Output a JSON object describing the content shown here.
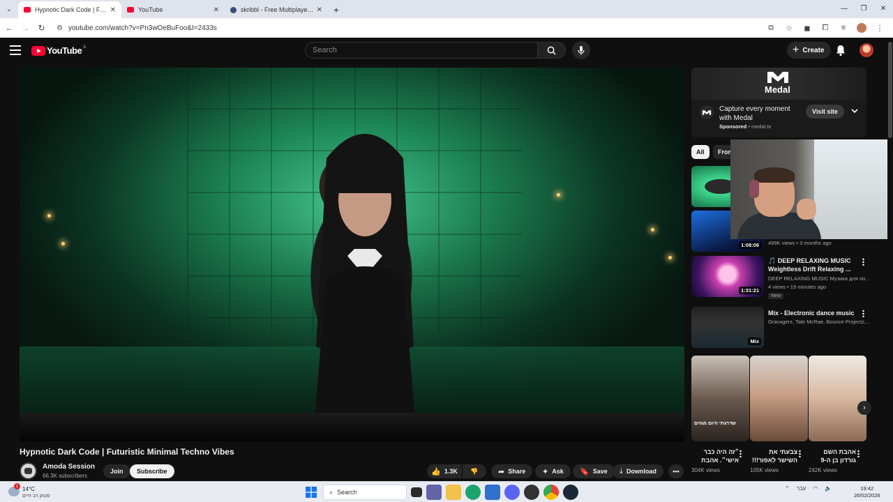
{
  "browser": {
    "tabs": [
      {
        "title": "Hypnotic Dark Code | Futuristic",
        "active": true
      },
      {
        "title": "YouTube",
        "active": false
      },
      {
        "title": "skribbl - Free Multiplayer Drawi",
        "active": false
      }
    ],
    "url": "youtube.com/watch?v=Pn3wOeBuFoo&t=2433s"
  },
  "masthead": {
    "logo_text": "YouTube",
    "country_code": "IL",
    "search_placeholder": "Search",
    "create_label": "Create"
  },
  "video": {
    "title": "Hypnotic Dark Code | Futuristic Minimal Techno Vibes",
    "channel": "Amoda Session",
    "subscribers": "66.3K subscribers",
    "join_label": "Join",
    "subscribe_label": "Subscribe",
    "likes": "1.3K",
    "share_label": "Share",
    "ask_label": "Ask",
    "save_label": "Save",
    "download_label": "Download"
  },
  "ad": {
    "brand": "Medal",
    "headline": "Capture every moment with Medal",
    "sponsored": "Sponsored",
    "domain": "medal.tv",
    "visit_label": "Visit site"
  },
  "chips": [
    {
      "label": "All",
      "selected": true
    },
    {
      "label": "From",
      "selected": false
    }
  ],
  "recommendations": [
    {
      "duration": "",
      "title": "",
      "meta1": "",
      "meta2": ""
    },
    {
      "duration": "1:08:06",
      "title": "",
      "meta1": "499K views • 3 months ago",
      "meta2": ""
    },
    {
      "duration": "1:31:21",
      "title": "🎵 DEEP RELAXING MUSIC Weightless Drift Relaxing ...",
      "meta1": "DEEP RELAXING MUSIC Музика для по...",
      "meta2": "4 views • 19 minutes ago",
      "badge": "New"
    },
    {
      "duration": "Mix",
      "title": "Mix - Electronic dance music",
      "meta1": "Gravagerz, Tate McRae, Bounce Projectz,...",
      "meta2": ""
    }
  ],
  "shorts": [
    {
      "title": "״זה היה כבר אישי״. אהבת",
      "views": "304K views",
      "caption": "שדרגתי היום מגזים"
    },
    {
      "title": "צבעתי את השישר לאפור!!!",
      "views": "105K views",
      "caption": ""
    },
    {
      "title": "אהבת השם גורדון בן ה-9",
      "views": "242K views",
      "caption": ""
    }
  ],
  "taskbar": {
    "temp": "14°C",
    "weather_desc": "סטוק רב חיים",
    "weather_badge": "1",
    "search_label": "Search",
    "lang": "עבר",
    "time": "19:42",
    "date": "26/02/2026"
  },
  "colors": {
    "yt_red": "#ff0033",
    "bg": "#0f0f0f",
    "chip_bg": "#272727"
  }
}
